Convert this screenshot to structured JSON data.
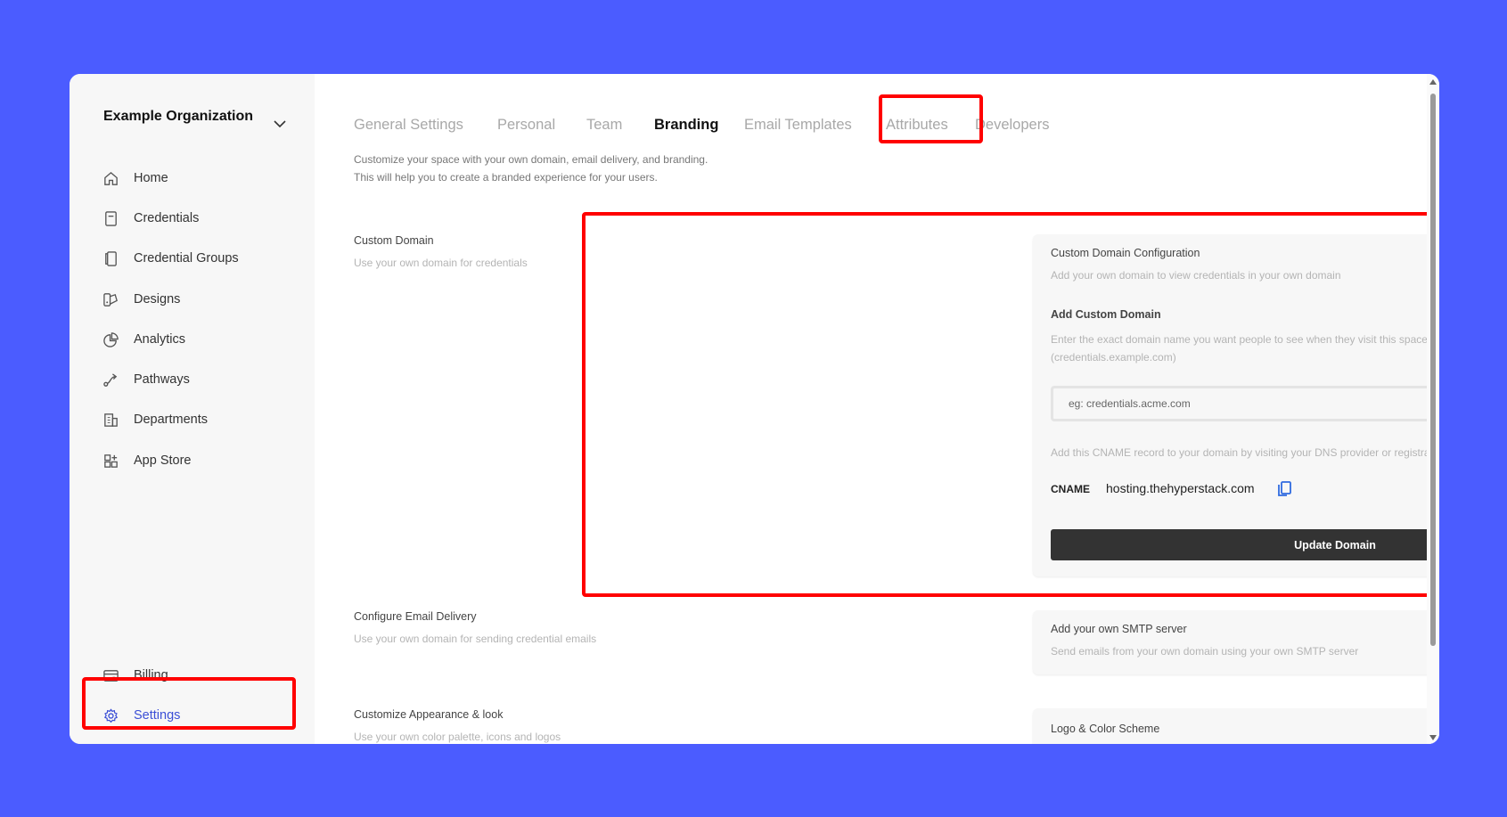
{
  "sidebar": {
    "org_name": "Example Organization",
    "items": [
      {
        "label": "Home",
        "icon": "home-icon"
      },
      {
        "label": "Credentials",
        "icon": "document-icon"
      },
      {
        "label": "Credential Groups",
        "icon": "stack-icon"
      },
      {
        "label": "Designs",
        "icon": "palette-icon"
      },
      {
        "label": "Analytics",
        "icon": "pie-chart-icon"
      },
      {
        "label": "Pathways",
        "icon": "route-icon"
      },
      {
        "label": "Departments",
        "icon": "building-icon"
      },
      {
        "label": "App Store",
        "icon": "grid-plus-icon"
      }
    ],
    "bottom_items": [
      {
        "label": "Billing",
        "icon": "card-icon"
      },
      {
        "label": "Settings",
        "icon": "gear-icon"
      }
    ],
    "active": "Settings",
    "active_color": "#3b4fd6"
  },
  "tabs": [
    {
      "label": "General Settings"
    },
    {
      "label": "Personal"
    },
    {
      "label": "Team"
    },
    {
      "label": "Branding"
    },
    {
      "label": "Email Templates"
    },
    {
      "label": "Attributes"
    },
    {
      "label": "Developers"
    }
  ],
  "active_tab": "Branding",
  "intro": {
    "line1": "Customize your space with your own domain, email delivery, and branding.",
    "line2": "This will help you to create a branded experience for your users."
  },
  "sections": {
    "custom_domain": {
      "title": "Custom Domain",
      "desc": "Use your own domain for credentials",
      "card": {
        "title": "Custom Domain Configuration",
        "desc": "Add your own domain to view credentials in your own domain",
        "add_title": "Add Custom Domain",
        "add_desc_line1": "Enter the exact domain name you want people to see when they visit this space. It should be a subdomain",
        "add_desc_line2": "(credentials.example.com)",
        "input_placeholder": "eg: credentials.acme.com",
        "cname_note": "Add this CNAME record to your domain by visiting your DNS provider or registrar.",
        "cname_label": "CNAME",
        "cname_value": "hosting.thehyperstack.com",
        "button_label": "Update Domain"
      }
    },
    "email_delivery": {
      "title": "Configure Email Delivery",
      "desc": "Use your own domain for sending credential emails",
      "card": {
        "title": "Add your own SMTP server",
        "desc": "Send emails from your own domain using your own SMTP server"
      }
    },
    "appearance": {
      "title": "Customize Appearance & look",
      "desc": "Use your own color palette, icons and logos",
      "card": {
        "title": "Logo & Color Scheme"
      }
    }
  },
  "colors": {
    "background": "#4b5cff",
    "highlight": "#ff0000",
    "button": "#333333",
    "copy_icon": "#2f6ae0"
  }
}
